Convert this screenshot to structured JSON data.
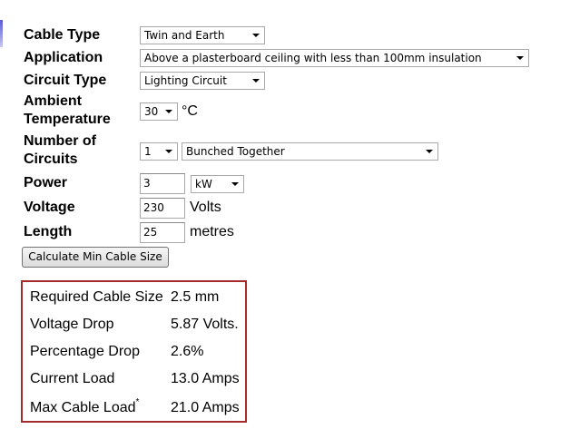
{
  "form": {
    "cable_type": {
      "label": "Cable Type",
      "value": "Twin and Earth"
    },
    "application": {
      "label": "Application",
      "value": "Above a plasterboard ceiling with less than 100mm insulation"
    },
    "circuit_type": {
      "label": "Circuit Type",
      "value": "Lighting Circuit"
    },
    "ambient_temperature": {
      "label_line1": "Ambient",
      "label_line2": "Temperature",
      "value": "30",
      "unit": "°C"
    },
    "number_of_circuits": {
      "label_line1": "Number of",
      "label_line2": "Circuits",
      "value": "1",
      "grouping": "Bunched Together"
    },
    "power": {
      "label": "Power",
      "value": "3",
      "unit": "kW"
    },
    "voltage": {
      "label": "Voltage",
      "value": "230",
      "unit": "Volts"
    },
    "length": {
      "label": "Length",
      "value": "25",
      "unit": "metres"
    },
    "calculate_label": "Calculate Min Cable Size"
  },
  "results": {
    "required_cable_size": {
      "label": "Required Cable Size",
      "value": "2.5 mm"
    },
    "voltage_drop": {
      "label": "Voltage Drop",
      "value": "5.87 Volts."
    },
    "percentage_drop": {
      "label": "Percentage Drop",
      "value": "2.6%"
    },
    "current_load": {
      "label": "Current Load",
      "value": "13.0 Amps"
    },
    "max_cable_load": {
      "label": "Max Cable Load",
      "footnote_mark": "*",
      "value": "21.0 Amps"
    }
  },
  "colors": {
    "results_border": "#a52a2a",
    "accent_bar": "#5a5ad8"
  }
}
